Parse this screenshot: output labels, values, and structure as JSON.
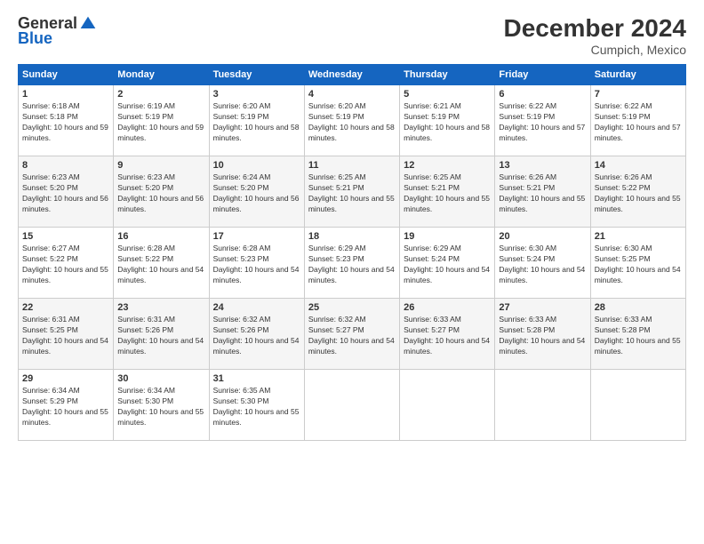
{
  "logo": {
    "general": "General",
    "blue": "Blue"
  },
  "header": {
    "title": "December 2024",
    "location": "Cumpich, Mexico"
  },
  "weekdays": [
    "Sunday",
    "Monday",
    "Tuesday",
    "Wednesday",
    "Thursday",
    "Friday",
    "Saturday"
  ],
  "weeks": [
    [
      {
        "day": "1",
        "sunrise": "6:18 AM",
        "sunset": "5:18 PM",
        "daylight": "10 hours and 59 minutes."
      },
      {
        "day": "2",
        "sunrise": "6:19 AM",
        "sunset": "5:19 PM",
        "daylight": "10 hours and 59 minutes."
      },
      {
        "day": "3",
        "sunrise": "6:20 AM",
        "sunset": "5:19 PM",
        "daylight": "10 hours and 58 minutes."
      },
      {
        "day": "4",
        "sunrise": "6:20 AM",
        "sunset": "5:19 PM",
        "daylight": "10 hours and 58 minutes."
      },
      {
        "day": "5",
        "sunrise": "6:21 AM",
        "sunset": "5:19 PM",
        "daylight": "10 hours and 58 minutes."
      },
      {
        "day": "6",
        "sunrise": "6:22 AM",
        "sunset": "5:19 PM",
        "daylight": "10 hours and 57 minutes."
      },
      {
        "day": "7",
        "sunrise": "6:22 AM",
        "sunset": "5:19 PM",
        "daylight": "10 hours and 57 minutes."
      }
    ],
    [
      {
        "day": "8",
        "sunrise": "6:23 AM",
        "sunset": "5:20 PM",
        "daylight": "10 hours and 56 minutes."
      },
      {
        "day": "9",
        "sunrise": "6:23 AM",
        "sunset": "5:20 PM",
        "daylight": "10 hours and 56 minutes."
      },
      {
        "day": "10",
        "sunrise": "6:24 AM",
        "sunset": "5:20 PM",
        "daylight": "10 hours and 56 minutes."
      },
      {
        "day": "11",
        "sunrise": "6:25 AM",
        "sunset": "5:21 PM",
        "daylight": "10 hours and 55 minutes."
      },
      {
        "day": "12",
        "sunrise": "6:25 AM",
        "sunset": "5:21 PM",
        "daylight": "10 hours and 55 minutes."
      },
      {
        "day": "13",
        "sunrise": "6:26 AM",
        "sunset": "5:21 PM",
        "daylight": "10 hours and 55 minutes."
      },
      {
        "day": "14",
        "sunrise": "6:26 AM",
        "sunset": "5:22 PM",
        "daylight": "10 hours and 55 minutes."
      }
    ],
    [
      {
        "day": "15",
        "sunrise": "6:27 AM",
        "sunset": "5:22 PM",
        "daylight": "10 hours and 55 minutes."
      },
      {
        "day": "16",
        "sunrise": "6:28 AM",
        "sunset": "5:22 PM",
        "daylight": "10 hours and 54 minutes."
      },
      {
        "day": "17",
        "sunrise": "6:28 AM",
        "sunset": "5:23 PM",
        "daylight": "10 hours and 54 minutes."
      },
      {
        "day": "18",
        "sunrise": "6:29 AM",
        "sunset": "5:23 PM",
        "daylight": "10 hours and 54 minutes."
      },
      {
        "day": "19",
        "sunrise": "6:29 AM",
        "sunset": "5:24 PM",
        "daylight": "10 hours and 54 minutes."
      },
      {
        "day": "20",
        "sunrise": "6:30 AM",
        "sunset": "5:24 PM",
        "daylight": "10 hours and 54 minutes."
      },
      {
        "day": "21",
        "sunrise": "6:30 AM",
        "sunset": "5:25 PM",
        "daylight": "10 hours and 54 minutes."
      }
    ],
    [
      {
        "day": "22",
        "sunrise": "6:31 AM",
        "sunset": "5:25 PM",
        "daylight": "10 hours and 54 minutes."
      },
      {
        "day": "23",
        "sunrise": "6:31 AM",
        "sunset": "5:26 PM",
        "daylight": "10 hours and 54 minutes."
      },
      {
        "day": "24",
        "sunrise": "6:32 AM",
        "sunset": "5:26 PM",
        "daylight": "10 hours and 54 minutes."
      },
      {
        "day": "25",
        "sunrise": "6:32 AM",
        "sunset": "5:27 PM",
        "daylight": "10 hours and 54 minutes."
      },
      {
        "day": "26",
        "sunrise": "6:33 AM",
        "sunset": "5:27 PM",
        "daylight": "10 hours and 54 minutes."
      },
      {
        "day": "27",
        "sunrise": "6:33 AM",
        "sunset": "5:28 PM",
        "daylight": "10 hours and 54 minutes."
      },
      {
        "day": "28",
        "sunrise": "6:33 AM",
        "sunset": "5:28 PM",
        "daylight": "10 hours and 55 minutes."
      }
    ],
    [
      {
        "day": "29",
        "sunrise": "6:34 AM",
        "sunset": "5:29 PM",
        "daylight": "10 hours and 55 minutes."
      },
      {
        "day": "30",
        "sunrise": "6:34 AM",
        "sunset": "5:30 PM",
        "daylight": "10 hours and 55 minutes."
      },
      {
        "day": "31",
        "sunrise": "6:35 AM",
        "sunset": "5:30 PM",
        "daylight": "10 hours and 55 minutes."
      },
      null,
      null,
      null,
      null
    ]
  ]
}
